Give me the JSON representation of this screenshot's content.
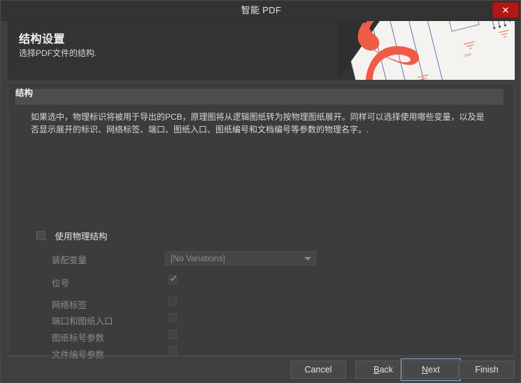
{
  "window": {
    "title": "智能 PDF",
    "close_label": "✕"
  },
  "banner": {
    "title": "结构设置",
    "subtitle": "选择PDF文件的结构.",
    "art_name": "acrobat-pdf-schematic-artwork"
  },
  "panel": {
    "group_title": "结构",
    "description": "如果选中，物理标识将被用于导出的PCB，原理图将从逻辑图纸转为按物理图纸展开。同样可以选择使用哪些变量，以及是否显示展开的标识、网络标签、端口、图纸入口、图纸编号和文档编号等参数的物理名字。."
  },
  "master_checkbox": {
    "label": "使用物理结构",
    "checked": false,
    "enabled": true
  },
  "variation": {
    "label": "装配变量",
    "value": "[No Variations]",
    "enabled": false
  },
  "options": [
    {
      "label": "位号",
      "checked": true,
      "enabled": false
    },
    {
      "label": "网络标签",
      "checked": false,
      "enabled": false
    },
    {
      "label": "端口和图纸入口",
      "checked": false,
      "enabled": false
    },
    {
      "label": "图纸标号参数",
      "checked": false,
      "enabled": false
    },
    {
      "label": "文件编号参数",
      "checked": false,
      "enabled": false
    }
  ],
  "footer": {
    "cancel": "Cancel",
    "back_pre": "",
    "back_accel": "B",
    "back_post": "ack",
    "next_accel": "N",
    "next_post": "ext",
    "finish": "Finish",
    "focused_button": "next"
  },
  "colors": {
    "window_bg": "#3f3f3f",
    "titlebar_bg": "#333333",
    "panel_bg": "#3c3c3c",
    "group_header_bg": "#4d4d4d",
    "close_red": "#b41616",
    "accent_focus": "#8fb4d9",
    "acrobat_red": "#ef5b46",
    "text_primary": "#e4e4e4",
    "text_disabled": "#8c8c8c"
  }
}
